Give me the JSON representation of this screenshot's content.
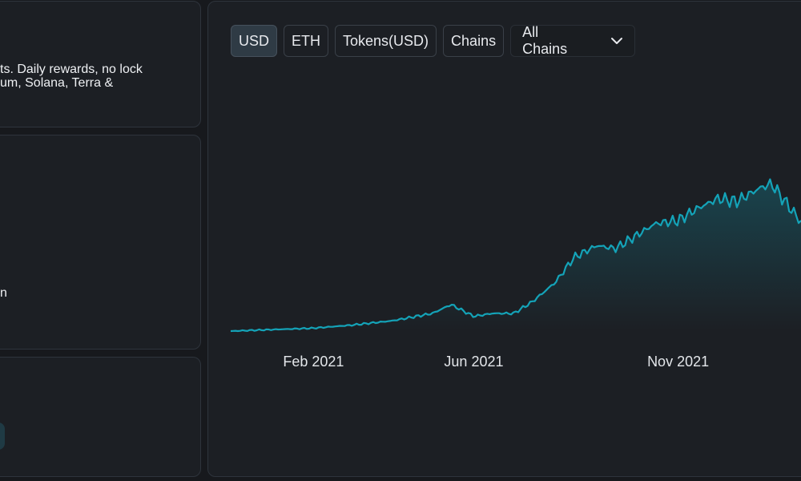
{
  "left_panel": {
    "description_lines": [
      "ts. Daily rewards, no lock",
      "um, Solana, Terra &"
    ],
    "mid_fragment": "n"
  },
  "toolbar": {
    "usd_label": "USD",
    "eth_label": "ETH",
    "tokens_label": "Tokens(USD)",
    "chains_label": "Chains",
    "chain_select_value": "All Chains"
  },
  "colors": {
    "line": "#14a3b8",
    "background": "#17191d",
    "panel": "#1c1f24"
  },
  "chart_data": {
    "type": "area",
    "x_tick_labels": [
      "Feb 2021",
      "Jun 2021",
      "Nov 2021"
    ],
    "series": [
      {
        "x": [
          "2020-12-01",
          "2021-01-01",
          "2021-02-01",
          "2021-03-01",
          "2021-04-01",
          "2021-05-01",
          "2021-05-15",
          "2021-06-01",
          "2021-06-15",
          "2021-07-01",
          "2021-07-15",
          "2021-08-01",
          "2021-08-15",
          "2021-09-01",
          "2021-09-15",
          "2021-10-01",
          "2021-10-15",
          "2021-11-01",
          "2021-11-15",
          "2021-12-01",
          "2021-12-15",
          "2022-01-01",
          "2022-01-10",
          "2022-01-20",
          "2022-02-01"
        ],
        "y": [
          0.0,
          0.01,
          0.02,
          0.04,
          0.07,
          0.12,
          0.18,
          0.1,
          0.12,
          0.12,
          0.2,
          0.33,
          0.5,
          0.58,
          0.56,
          0.65,
          0.73,
          0.75,
          0.83,
          0.9,
          0.88,
          0.97,
          1.0,
          0.88,
          0.74
        ]
      }
    ],
    "ylim": [
      0,
      1.05
    ],
    "grid": false,
    "legend": "none"
  }
}
